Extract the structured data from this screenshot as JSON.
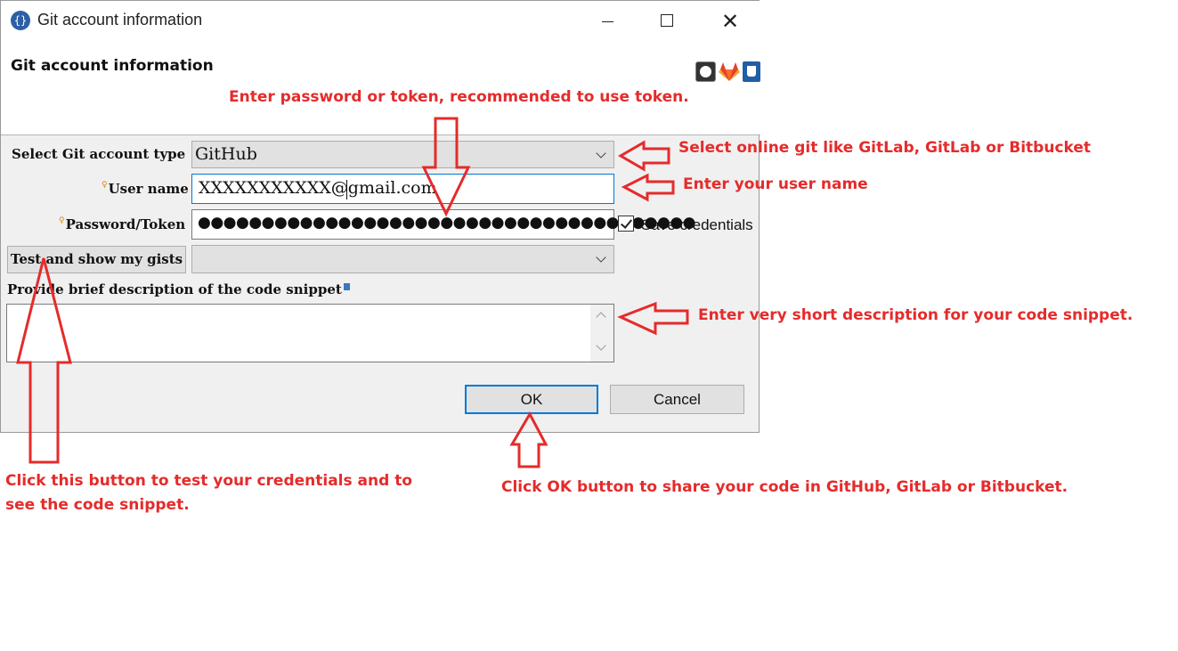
{
  "window": {
    "title": "Git account information",
    "app_icon": "braces-icon",
    "minimize": "minimize-icon",
    "maximize": "maximize-icon",
    "close": "✕"
  },
  "header": {
    "title": "Git account information",
    "provider_icons": [
      "github-icon",
      "gitlab-icon",
      "bitbucket-icon"
    ]
  },
  "form": {
    "account_type_label": "Select Git account type",
    "account_type_value": "GitHub",
    "required_marker": "♀",
    "username_label": "User name",
    "username_value": "XXXXXXXXXXX@gmail.com",
    "password_label": "Password/Token",
    "password_value": "●●●●●●●●●●●●●●●●●●●●●●●●●●●●●●●●●●●●●●●",
    "save_credentials_label": "Save credentials",
    "save_credentials_checked": true,
    "test_button_label": "Test and show my gists",
    "gists_value": "",
    "description_label": "Provide brief description of the code snippet",
    "description_value": ""
  },
  "buttons": {
    "ok": "OK",
    "cancel": "Cancel"
  },
  "annotations": {
    "password": "Enter password or token, recommended to use token.",
    "account_type": "Select online git like GitLab, GitLab or Bitbucket",
    "username": "Enter your user name",
    "description": "Enter very short description for your code snippet.",
    "test_line1": "Click this button to test your credentials and to",
    "test_line2": "see the code snippet.",
    "ok": "Click OK button to share your code in GitHub, GitLab or Bitbucket."
  },
  "colors": {
    "annotation": "#e52b2b",
    "focus_border": "#0078d7"
  }
}
